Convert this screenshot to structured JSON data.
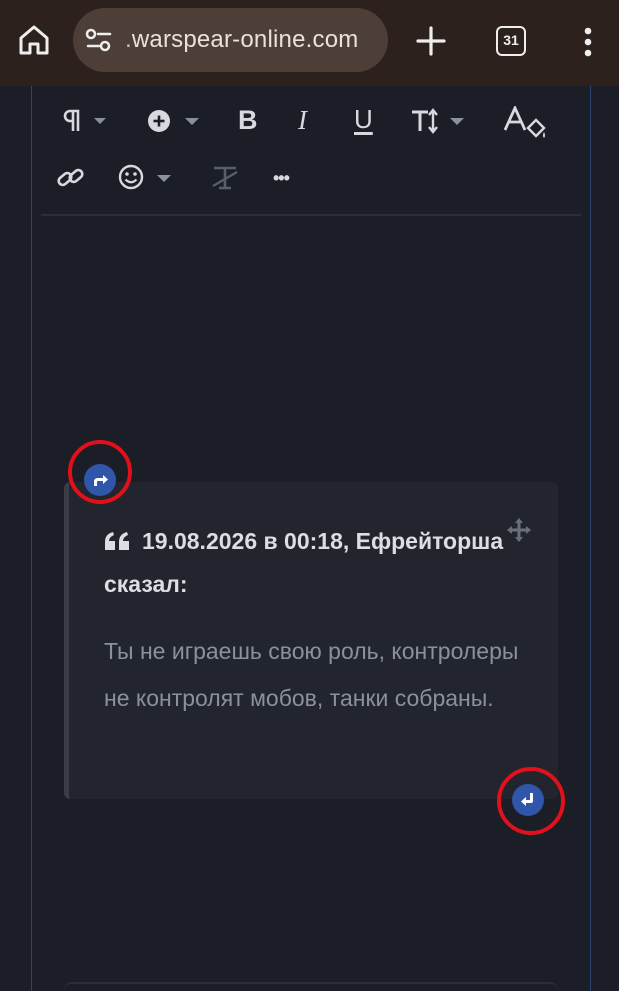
{
  "browser": {
    "url": ".warspear-online.com",
    "tab_count": "31"
  },
  "toolbar": {
    "items": [
      "paragraph-format",
      "insert",
      "bold",
      "italic",
      "underline",
      "text-size",
      "text-color",
      "link",
      "emoji",
      "clear-format",
      "more"
    ],
    "bold_label": "B",
    "italic_label": "I",
    "underline_label": "U",
    "more_label": "•••"
  },
  "quote": {
    "header": "19.08.2026 в 00:18, Ефрейторша сказал:",
    "body": "Ты не играешь свою роль, контролеры не контролят мобов, танки собраны."
  },
  "colors": {
    "accent": "#2f56a8",
    "highlight_ring": "#e1101a",
    "background": "#1b1e26",
    "browser_bar": "#2c211c"
  }
}
